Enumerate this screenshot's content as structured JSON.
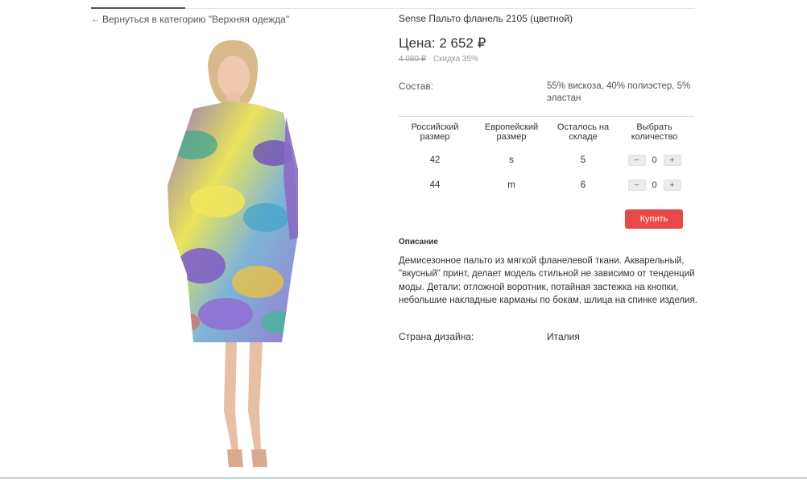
{
  "nav": {
    "back_link": "Вернуться в категорию \"Верхняя одежда\""
  },
  "product": {
    "title": "Sense Пальто фланель 2105 (цветной)",
    "price": "Цена: 2 652 ₽",
    "old_price": "4 080 ₽",
    "discount": "Скидка 35%",
    "composition_label": "Состав:",
    "composition_value": "55% вискоза, 40% полиэстер, 5% эластан",
    "buy_label": "Купить",
    "description_title": "Описание",
    "description": "Демисезонное пальто из мягкой фланелевой ткани. Акварельный, \"вкусный\" принт, делает модель стильной не зависимо от тенденций моды. Детали: отложной воротник, потайная застежка на кнопки, небольшие накладные карманы по бокам, шлица на спинке изделия.",
    "country_label": "Страна дизайна:",
    "country_value": "Италия"
  },
  "sizes": {
    "headers": [
      "Российский размер",
      "Европейский размер",
      "Осталось на складе",
      "Выбрать количество"
    ],
    "rows": [
      {
        "ru": "42",
        "eu": "s",
        "stock": "5",
        "qty": "0"
      },
      {
        "ru": "44",
        "eu": "m",
        "stock": "6",
        "qty": "0"
      }
    ],
    "minus": "−",
    "plus": "+"
  },
  "colors": {
    "accent": "#ea4848"
  }
}
